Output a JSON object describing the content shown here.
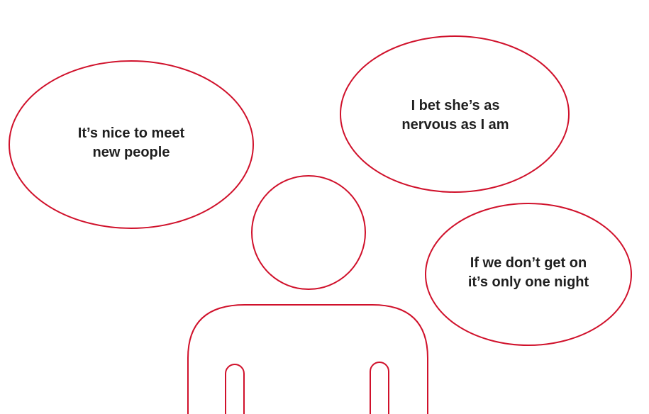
{
  "colors": {
    "outline": "#d0112b",
    "text": "#1f1f1f",
    "background": "#ffffff"
  },
  "thought_bubbles": [
    {
      "line1": "It’s nice to meet",
      "line2": "new people"
    },
    {
      "line1": "I bet she’s as",
      "line2": "nervous as I am"
    },
    {
      "line1": "If we don’t get on",
      "line2": "it’s only one night"
    }
  ],
  "figure": {
    "icon": "person-outline-icon"
  }
}
